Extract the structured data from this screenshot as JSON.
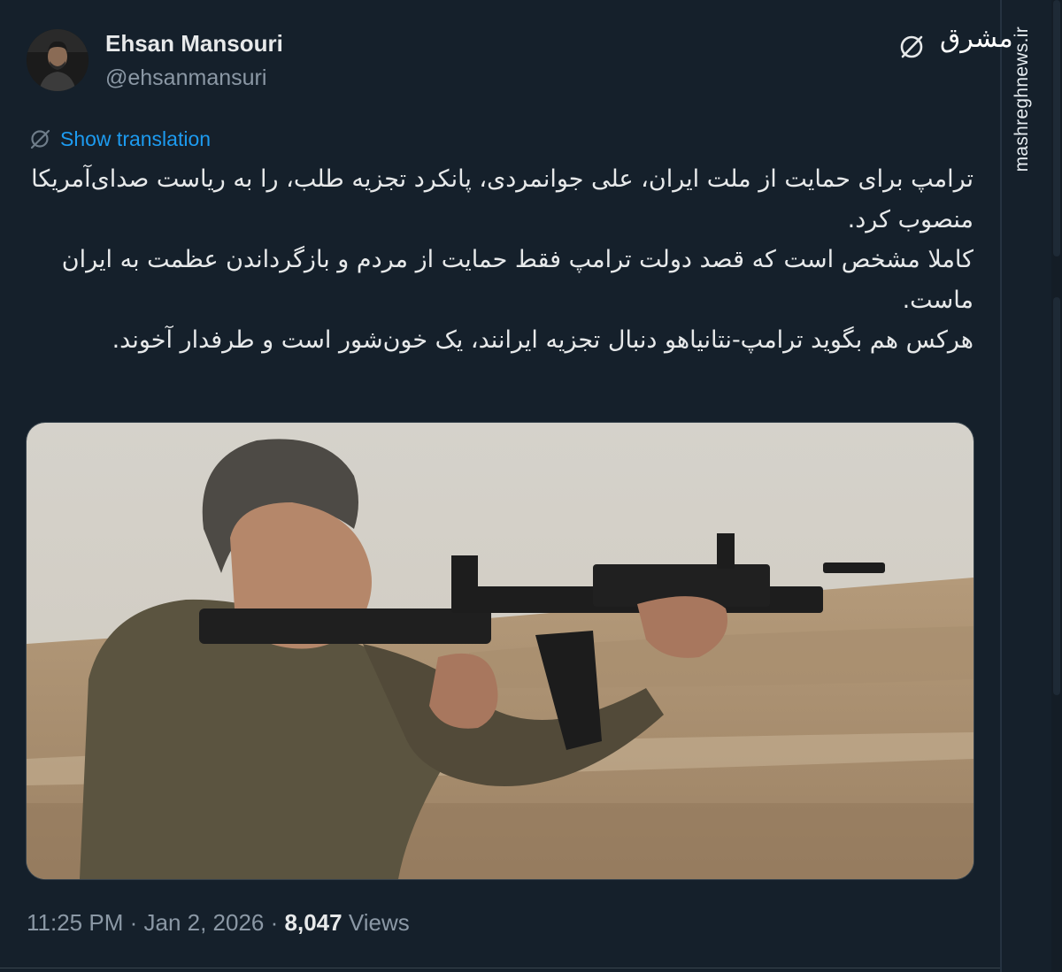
{
  "author": {
    "display_name": "Ehsan Mansouri",
    "handle": "@ehsanmansuri"
  },
  "translation": {
    "label": "Show translation"
  },
  "tweet": {
    "lines": [
      "ترامپ برای حمایت از ملت ایران، علی جوانمردی، پانکرد تجزیه طلب، را به ریاست صدای‌آمریکا منصوب کرد.",
      "کاملا مشخص است که قصد دولت ترامپ فقط حمایت از مردم و بازگرداندن عظمت به ایران ماست.",
      "هرکس هم بگوید ترامپ-نتانیاهو دنبال تجزیه ایرانند، یک خون‌شور است و طرفدار آخوند."
    ]
  },
  "media": {
    "alt": "Man aiming a rifle outdoors"
  },
  "meta": {
    "time": "11:25 PM",
    "separator": "·",
    "date": "Jan 2, 2026",
    "views_count": "8,047",
    "views_label": "Views"
  },
  "watermark": {
    "site": "mashreghnews.ir",
    "logo_text": "مشرق"
  },
  "icons": {
    "grok": "grok-icon",
    "translate": "translate-icon"
  },
  "colors": {
    "background": "#15202b",
    "text": "#e7e9ea",
    "secondary_text": "#8b98a5",
    "link": "#1d9bf0"
  }
}
